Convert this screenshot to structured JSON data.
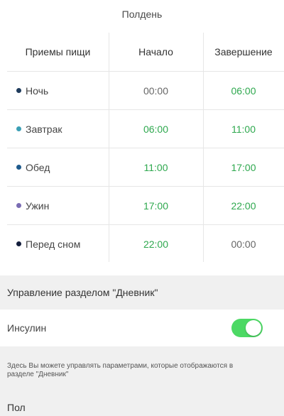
{
  "time_picker": {
    "label": "Полдень"
  },
  "table": {
    "headers": {
      "meal": "Приемы пищи",
      "start": "Начало",
      "end": "Завершение"
    },
    "rows": [
      {
        "name": "Ночь",
        "dot_color": "#1f3b5c",
        "start": "00:00",
        "start_color": "gray",
        "end": "06:00",
        "end_color": "green"
      },
      {
        "name": "Завтрак",
        "dot_color": "#3b9fb5",
        "start": "06:00",
        "start_color": "green",
        "end": "11:00",
        "end_color": "green"
      },
      {
        "name": "Обед",
        "dot_color": "#1e5a8c",
        "start": "11:00",
        "start_color": "green",
        "end": "17:00",
        "end_color": "green"
      },
      {
        "name": "Ужин",
        "dot_color": "#7a6cb3",
        "start": "17:00",
        "start_color": "green",
        "end": "22:00",
        "end_color": "green"
      },
      {
        "name": "Перед сном",
        "dot_color": "#141e3c",
        "start": "22:00",
        "start_color": "green",
        "end": "00:00",
        "end_color": "gray"
      }
    ]
  },
  "diary_section": {
    "title": "Управление разделом \"Дневник\"",
    "insulin": {
      "label": "Инсулин",
      "enabled": true,
      "toggle_color": "#4cd964"
    },
    "hint": "Здесь Вы можете управлять параметрами, которые отображаются в разделе \"Дневник\"",
    "gender_label": "Пол"
  },
  "colors": {
    "green": "#2ea84e",
    "gray": "#666666",
    "section_bg": "#f0f0f0"
  }
}
